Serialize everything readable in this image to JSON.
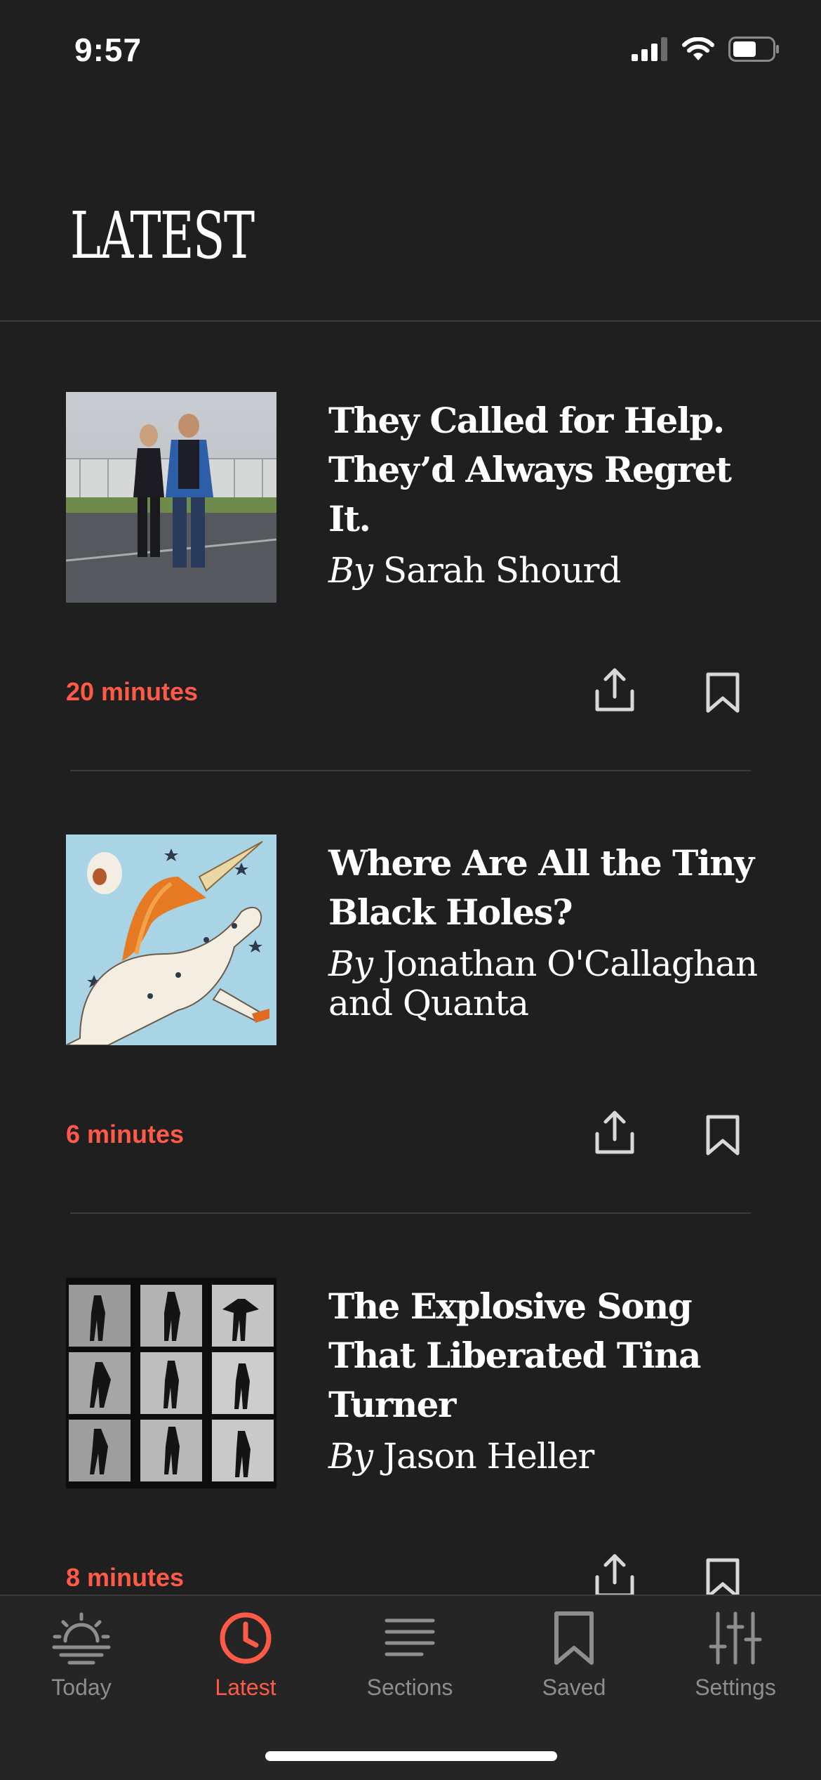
{
  "status_bar": {
    "time": "9:57"
  },
  "page": {
    "title": "LATEST"
  },
  "articles": [
    {
      "title": "They Called for Help. They’d Always Regret It.",
      "by": "By",
      "author": "Sarah Shourd",
      "read_time": "20 minutes"
    },
    {
      "title": "Where Are All the Tiny Black Holes?",
      "by": "By",
      "author": "Jonathan O'Callaghan and Quanta",
      "read_time": "6 minutes"
    },
    {
      "title": "The Explosive Song That Liberated Tina Turner",
      "by": "By",
      "author": "Jason Heller",
      "read_time": "8 minutes"
    }
  ],
  "tab_bar": {
    "tabs": [
      {
        "label": "Today",
        "icon": "sunrise-icon"
      },
      {
        "label": "Latest",
        "icon": "clock-icon"
      },
      {
        "label": "Sections",
        "icon": "lines-icon"
      },
      {
        "label": "Saved",
        "icon": "bookmark-icon"
      },
      {
        "label": "Settings",
        "icon": "sliders-icon"
      }
    ],
    "active": "Latest"
  },
  "colors": {
    "background": "#1f1f1f",
    "accent": "#ff5a47",
    "tab_inactive": "#8e8e8e"
  }
}
